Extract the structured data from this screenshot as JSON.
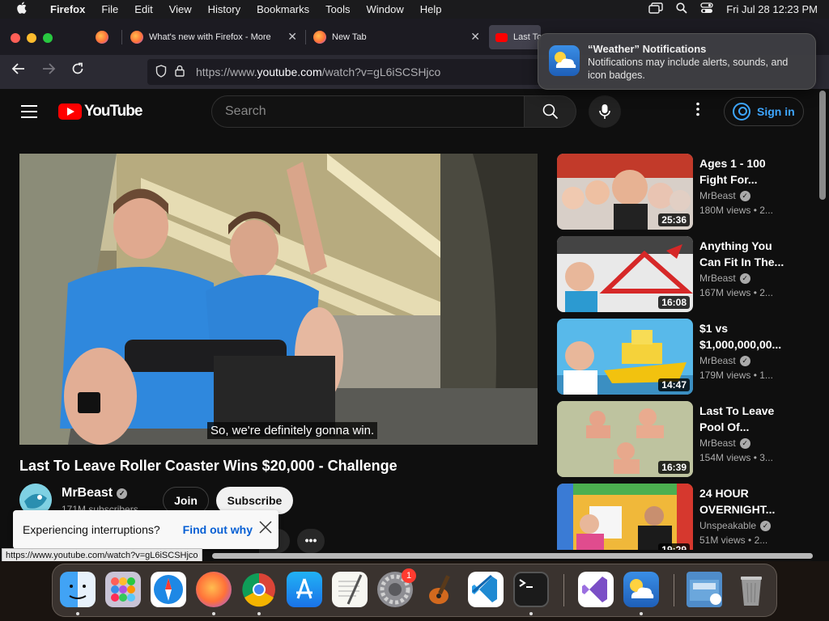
{
  "menubar": {
    "app": "Firefox",
    "items": [
      "File",
      "Edit",
      "View",
      "History",
      "Bookmarks",
      "Tools",
      "Window",
      "Help"
    ],
    "clock": "Fri Jul 28  12:23 PM"
  },
  "tabs": [
    {
      "title": "What's new with Firefox - More"
    },
    {
      "title": "New Tab"
    },
    {
      "title": "Last To"
    }
  ],
  "address_bar": {
    "prefix": "https://www.",
    "host": "youtube.com",
    "path": "/watch?v=gL6iSCSHjco"
  },
  "notification": {
    "title": "“Weather” Notifications",
    "body": "Notifications may include alerts, sounds, and icon badges."
  },
  "youtube": {
    "logo_text": "YouTube",
    "search_placeholder": "Search",
    "sign_in": "Sign in"
  },
  "video": {
    "caption": "So, we're definitely gonna win.",
    "title": "Last To Leave Roller Coaster Wins $20,000 - Challenge",
    "channel": "MrBeast",
    "subscribers": "171M subscribers",
    "join_label": "Join",
    "subscribe_label": "Subscribe",
    "more_label": "•••"
  },
  "toast": {
    "message": "Experiencing interruptions?",
    "link": "Find out why"
  },
  "status_url": "https://www.youtube.com/watch?v=gL6iSCSHjco",
  "recommendations": [
    {
      "title": "Ages 1 - 100 Fight For...",
      "channel": "MrBeast",
      "views": "180M views",
      "age": "• 2...",
      "duration": "25:36",
      "colors": [
        "#c9452f",
        "#f0d8c6"
      ]
    },
    {
      "title": "Anything You Can Fit In The...",
      "channel": "MrBeast",
      "views": "167M views",
      "age": "• 2...",
      "duration": "16:08",
      "colors": [
        "#e8e8e8",
        "#d62828"
      ]
    },
    {
      "title": "$1 vs $1,000,000,00...",
      "channel": "MrBeast",
      "views": "179M views",
      "age": "• 1...",
      "duration": "14:47",
      "colors": [
        "#4fb6e8",
        "#f2c20f"
      ]
    },
    {
      "title": "Last To Leave Pool Of...",
      "channel": "MrBeast",
      "views": "154M views",
      "age": "• 3...",
      "duration": "16:39",
      "colors": [
        "#9fb28e",
        "#d9c9a6"
      ]
    },
    {
      "title": "24 HOUR OVERNIGHT...",
      "channel": "Unspeakable",
      "views": "51M views",
      "age": "• 2...",
      "duration": "19:29",
      "colors": [
        "#e9b52b",
        "#3a7bd5"
      ]
    }
  ],
  "badges": {
    "settings": "1"
  },
  "colors": {
    "brand_red": "#ff0000",
    "link_blue": "#3ea6ff",
    "toast_link": "#065fd4"
  }
}
